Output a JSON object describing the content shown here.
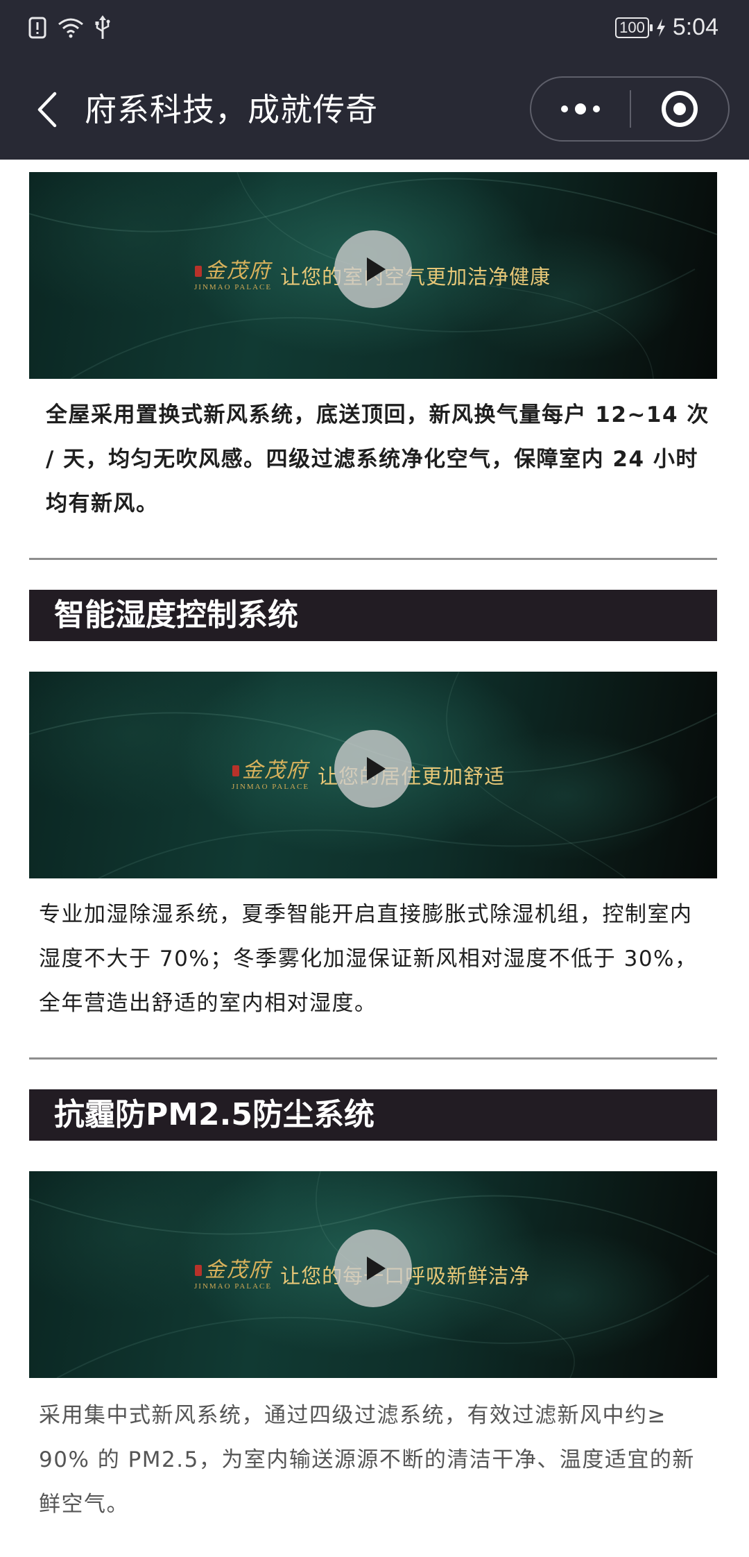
{
  "status_bar": {
    "icons": [
      "notification-alert-icon",
      "wifi-icon",
      "usb-icon",
      "charging-icon"
    ],
    "battery": "100",
    "time": "5:04"
  },
  "nav": {
    "title": "府系科技，成就传奇",
    "icons": [
      "back-arrow-icon",
      "more-dots-icon",
      "close-miniprogram-icon"
    ]
  },
  "logo": {
    "cn": "金茂府",
    "en": "JINMAO PALACE"
  },
  "sections": [
    {
      "header": "",
      "video_slogan": "让您的室内空气更加洁净健康",
      "description": "全屋采用置换式新风系统，底送顶回，新风换气量每户 12~14 次 / 天，均匀无吹风感。四级过滤系统净化空气，保障室内 24 小时均有新风。"
    },
    {
      "header": "智能湿度控制系统",
      "video_slogan": "让您的居住更加舒适",
      "description": "专业加湿除湿系统，夏季智能开启直接膨胀式除湿机组，控制室内湿度不大于 70%；冬季雾化加湿保证新风相对湿度不低于 30%，全年营造出舒适的室内相对湿度。"
    },
    {
      "header": "抗霾防PM2.5防尘系统",
      "video_slogan": "让您的每一口呼吸新鲜洁净",
      "description": "采用集中式新风系统，通过四级过滤系统，有效过滤新风中约≥ 90% 的 PM2.5，为室内输送源源不断的清洁干净、温度适宜的新鲜空气。"
    }
  ],
  "colors": {
    "bar_background": "#282934",
    "section_header_background": "#221c23",
    "slogan_gold": "#e7c777"
  }
}
